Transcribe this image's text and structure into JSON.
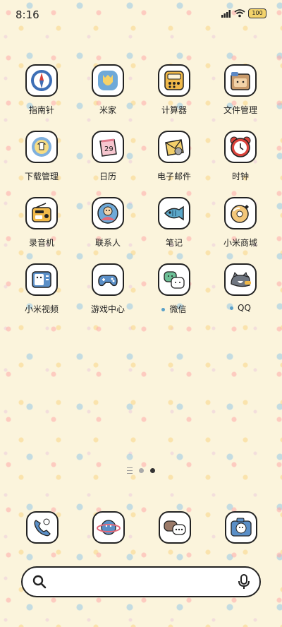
{
  "status": {
    "time": "8:16",
    "battery": "100"
  },
  "apps": [
    {
      "label": "指南针",
      "icon": "compass-icon"
    },
    {
      "label": "米家",
      "icon": "mijia-icon"
    },
    {
      "label": "计算器",
      "icon": "calculator-icon"
    },
    {
      "label": "文件管理",
      "icon": "file-manager-icon"
    },
    {
      "label": "下载管理",
      "icon": "download-manager-icon"
    },
    {
      "label": "日历",
      "icon": "calendar-icon"
    },
    {
      "label": "电子邮件",
      "icon": "email-icon"
    },
    {
      "label": "时钟",
      "icon": "alarm-clock-icon"
    },
    {
      "label": "录音机",
      "icon": "radio-recorder-icon"
    },
    {
      "label": "联系人",
      "icon": "contacts-icon"
    },
    {
      "label": "笔记",
      "icon": "fish-notes-icon"
    },
    {
      "label": "小米商城",
      "icon": "donut-store-icon"
    },
    {
      "label": "小米视频",
      "icon": "tv-video-icon"
    },
    {
      "label": "游戏中心",
      "icon": "gamepad-icon"
    },
    {
      "label": "微信",
      "icon": "wechat-cats-icon",
      "new_indicator": true
    },
    {
      "label": "QQ",
      "icon": "qq-cat-icon",
      "new_indicator": true
    }
  ],
  "dock": [
    {
      "icon": "phone-icon"
    },
    {
      "icon": "planet-browser-icon"
    },
    {
      "icon": "messages-chat-icon"
    },
    {
      "icon": "camera-icon"
    }
  ],
  "page_indicator": {
    "pages": 2,
    "active": 2
  }
}
